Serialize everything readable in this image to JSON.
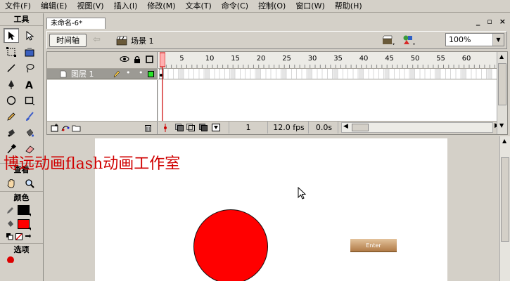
{
  "menu": [
    "文件(F)",
    "编辑(E)",
    "视图(V)",
    "插入(I)",
    "修改(M)",
    "文本(T)",
    "命令(C)",
    "控制(O)",
    "窗口(W)",
    "帮助(H)"
  ],
  "tools": {
    "header": "工具",
    "view_label": "查看",
    "colors_label": "颜色",
    "options_label": "选项",
    "stroke_color": "#000000",
    "fill_color": "#ff0000"
  },
  "document": {
    "tab_title": "未命名-6*",
    "window_controls": {
      "minimize": "_",
      "restore": "▫",
      "close": "×"
    }
  },
  "edit_bar": {
    "timeline_button": "时间轴",
    "scene_label": "场景 1",
    "zoom_value": "100%"
  },
  "timeline": {
    "frame_numbers": [
      "1",
      "5",
      "10",
      "15",
      "20",
      "25",
      "30",
      "35",
      "40",
      "45",
      "50",
      "55",
      "60"
    ],
    "layers": [
      {
        "name": "图层 1"
      }
    ],
    "current_frame": "1",
    "fps": "12.0 fps",
    "elapsed_time": "0.0s"
  },
  "stage": {
    "background_color": "#ffffff",
    "circle_color": "#ff0000",
    "enter_button_label": "Enter"
  },
  "watermark_text": "博远动画flash动画工作室"
}
